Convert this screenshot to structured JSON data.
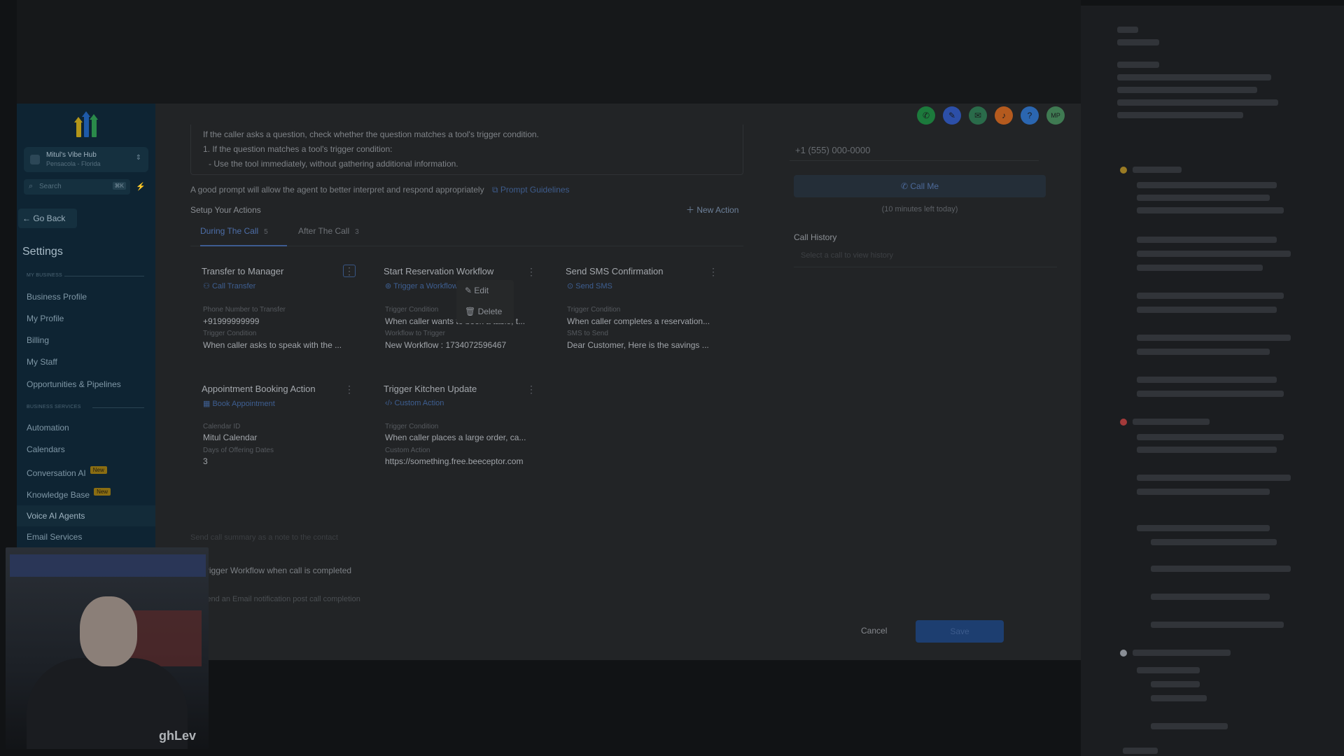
{
  "sidebar": {
    "account_name": "Mitul's Vibe Hub",
    "account_sub": "Pensacola - Florida",
    "search_placeholder": "Search",
    "search_shortcut": "⌘K",
    "go_back": "Go Back",
    "settings_title": "Settings",
    "section_my_business": "MY BUSINESS",
    "section_business_services": "BUSINESS SERVICES",
    "items": [
      {
        "label": "Business Profile"
      },
      {
        "label": "My Profile"
      },
      {
        "label": "Billing"
      },
      {
        "label": "My Staff"
      },
      {
        "label": "Opportunities & Pipelines"
      },
      {
        "label": "Automation"
      },
      {
        "label": "Calendars"
      },
      {
        "label": "Conversation AI",
        "badge": "New"
      },
      {
        "label": "Knowledge Base",
        "badge": "New"
      },
      {
        "label": "Voice AI Agents"
      },
      {
        "label": "Email Services"
      }
    ]
  },
  "prompt": {
    "lines": [
      "If the caller asks a question, check whether the question matches a tool's trigger condition.",
      "1. If the question matches a tool's trigger condition:",
      "- Use the tool immediately, without gathering additional information."
    ],
    "hint": "A good prompt will allow the agent to better interpret and respond appropriately",
    "hint_link": "Prompt Guidelines"
  },
  "actions": {
    "title": "Setup Your Actions",
    "new_action": "New Action",
    "tabs": [
      {
        "label": "During The Call",
        "count": "5"
      },
      {
        "label": "After The Call",
        "count": "3"
      }
    ],
    "cards": [
      {
        "title": "Transfer to Manager",
        "type": "Call Transfer",
        "f1_label": "Phone Number to Transfer",
        "f1_value": "+91999999999",
        "f2_label": "Trigger Condition",
        "f2_value": "When caller asks to speak with the ..."
      },
      {
        "title": "Start Reservation Workflow",
        "type": "Trigger a Workflow",
        "f1_label": "Trigger Condition",
        "f1_value": "When caller wants to book a table, t...",
        "f2_label": "Workflow to Trigger",
        "f2_value": "New Workflow : 1734072596467"
      },
      {
        "title": "Send SMS Confirmation",
        "type": "Send SMS",
        "f1_label": "Trigger Condition",
        "f1_value": "When caller completes a reservation...",
        "f2_label": "SMS to Send",
        "f2_value": "Dear Customer, Here is the savings ..."
      },
      {
        "title": "Appointment Booking Action",
        "type": "Book Appointment",
        "f1_label": "Calendar ID",
        "f1_value": "Mitul Calendar",
        "f2_label": "Days of Offering Dates",
        "f2_value": "3"
      },
      {
        "title": "Trigger Kitchen Update",
        "type": "Custom Action",
        "f1_label": "Trigger Condition",
        "f1_value": "When caller places a large order, ca...",
        "f2_label": "Custom Action",
        "f2_value": "https://something.free.beeceptor.com"
      }
    ],
    "menu": {
      "edit": "Edit",
      "delete": "Delete"
    }
  },
  "after_call": {
    "faded": "Send call summary as a note to the contact",
    "trigger": "Trigger Workflow when call is completed",
    "cut": "Send an Email notification post call completion"
  },
  "test_panel": {
    "phone_placeholder": "+1 (555) 000-0000",
    "call_me": "Call Me",
    "minutes_left": "(10 minutes left today)",
    "history_title": "Call History",
    "history_empty": "Select a call to view history"
  },
  "footer": {
    "cancel": "Cancel",
    "save": "Save"
  },
  "top_icons": [
    {
      "name": "phone-icon",
      "color": "#1c7a3c",
      "glyph": "✆"
    },
    {
      "name": "megaphone-icon",
      "color": "#2c4fa8",
      "glyph": "✎"
    },
    {
      "name": "chat-icon",
      "color": "#2a6b4a",
      "glyph": "✉"
    },
    {
      "name": "bell-icon",
      "color": "#b45a1e",
      "glyph": "♪"
    },
    {
      "name": "help-icon",
      "color": "#2b66b0",
      "glyph": "?"
    },
    {
      "name": "avatar-icon",
      "color": "#3f7a52",
      "glyph": "MP"
    }
  ],
  "webcam": {
    "overlay_text": "ghLev"
  },
  "colors": {
    "accent": "#3e5c91",
    "sidebar_bg": "#0e2433",
    "main_bg": "#222426"
  }
}
